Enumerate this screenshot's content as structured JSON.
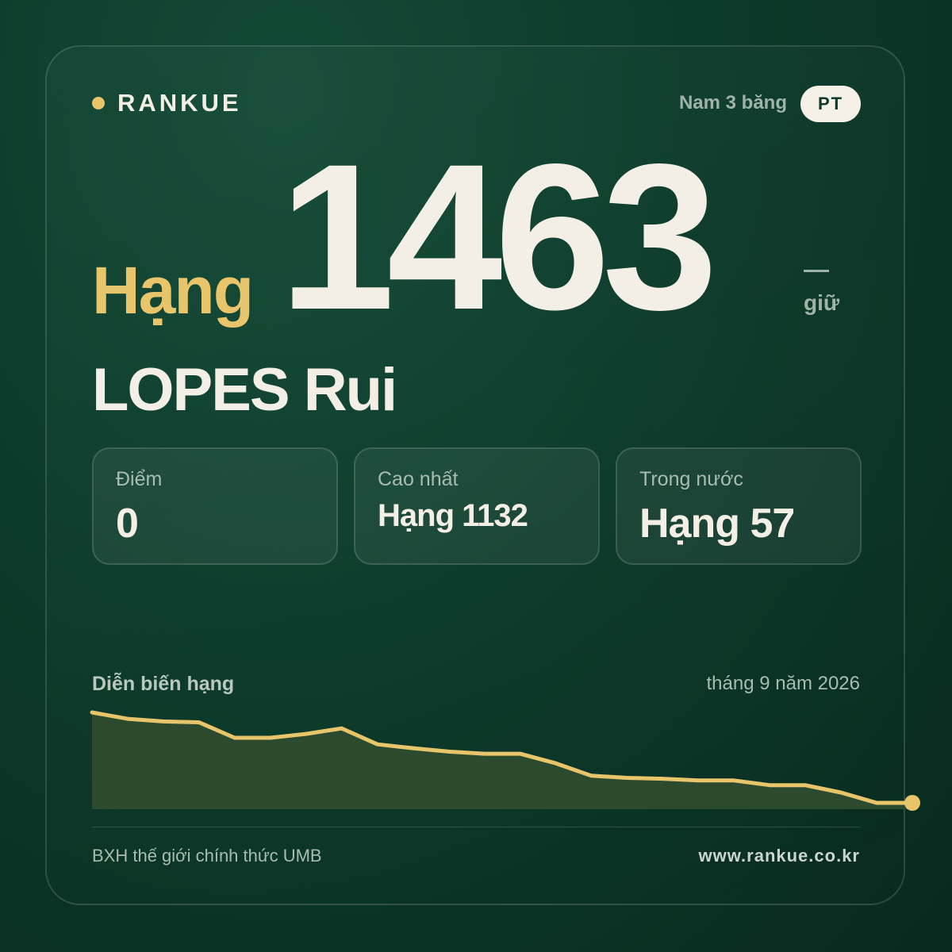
{
  "brand": {
    "name": "RANKUE"
  },
  "header": {
    "category": "Nam 3 băng",
    "country_code": "PT"
  },
  "rank": {
    "prefix": "Hạng",
    "value": "1463",
    "change_label": "giữ"
  },
  "player": {
    "name": "LOPES Rui"
  },
  "stats": [
    {
      "label": "Điểm",
      "value": "0"
    },
    {
      "label": "Cao nhất",
      "value": "Hạng 1132"
    },
    {
      "label": "Trong nước",
      "value": "Hạng 57"
    }
  ],
  "chart": {
    "title": "Diễn biến hạng",
    "date": "tháng 9 năm 2026"
  },
  "chart_data": {
    "type": "area",
    "title": "Diễn biến hạng",
    "y_inverted": true,
    "series": [
      {
        "values": [
          1147,
          1162,
          1168,
          1170,
          1206,
          1206,
          1197,
          1184,
          1221,
          1230,
          1238,
          1243,
          1243,
          1265,
          1294,
          1299,
          1301,
          1305,
          1305,
          1316,
          1316,
          1333,
          1357,
          1357
        ]
      }
    ],
    "colors": {
      "line": "#e8c46a",
      "fill": "#2b4a2e"
    }
  },
  "footer": {
    "source": "BXH thế giới chính thức UMB",
    "url": "www.rankue.co.kr"
  },
  "colors": {
    "accent": "#e8c46a",
    "background": "#0c3a2a",
    "text": "#f3efe4"
  }
}
